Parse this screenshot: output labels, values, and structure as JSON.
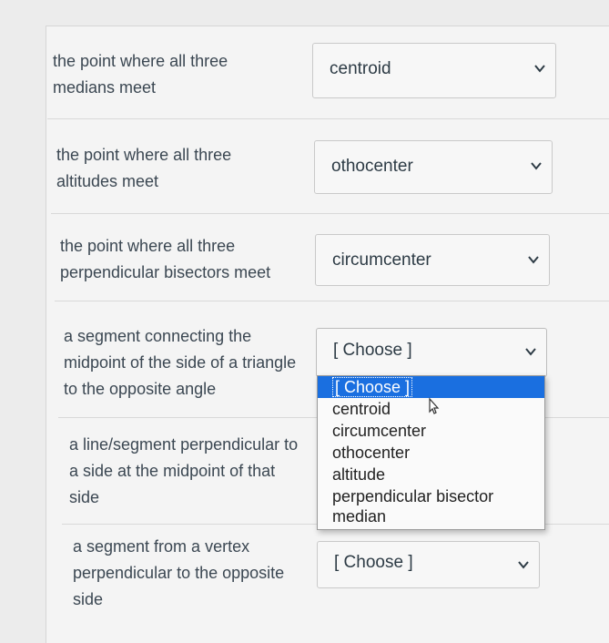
{
  "questions": [
    {
      "prompt_lines": [
        "the point where all three",
        "medians meet"
      ],
      "selected": "centroid"
    },
    {
      "prompt_lines": [
        "the point where all three",
        "altitudes meet"
      ],
      "selected": "othocenter"
    },
    {
      "prompt_lines": [
        "the point where all three",
        "perpendicular bisectors meet"
      ],
      "selected": "circumcenter"
    },
    {
      "prompt_lines": [
        "a segment connecting the",
        "midpoint of the side of a triangle",
        "to the opposite angle"
      ],
      "selected": "[ Choose ]"
    },
    {
      "prompt_lines": [
        "a line/segment perpendicular to",
        "a side at the midpoint of that",
        "side"
      ],
      "selected": ""
    },
    {
      "prompt_lines": [
        "a segment from a vertex",
        "perpendicular to the opposite",
        "side"
      ],
      "selected": "[ Choose ]"
    }
  ],
  "dropdown_options": [
    "[ Choose ]",
    "centroid",
    "circumcenter",
    "othocenter",
    "altitude",
    "perpendicular bisector",
    "median"
  ],
  "colors": {
    "highlight": "#1a6fe0",
    "text": "#2d3b45"
  }
}
